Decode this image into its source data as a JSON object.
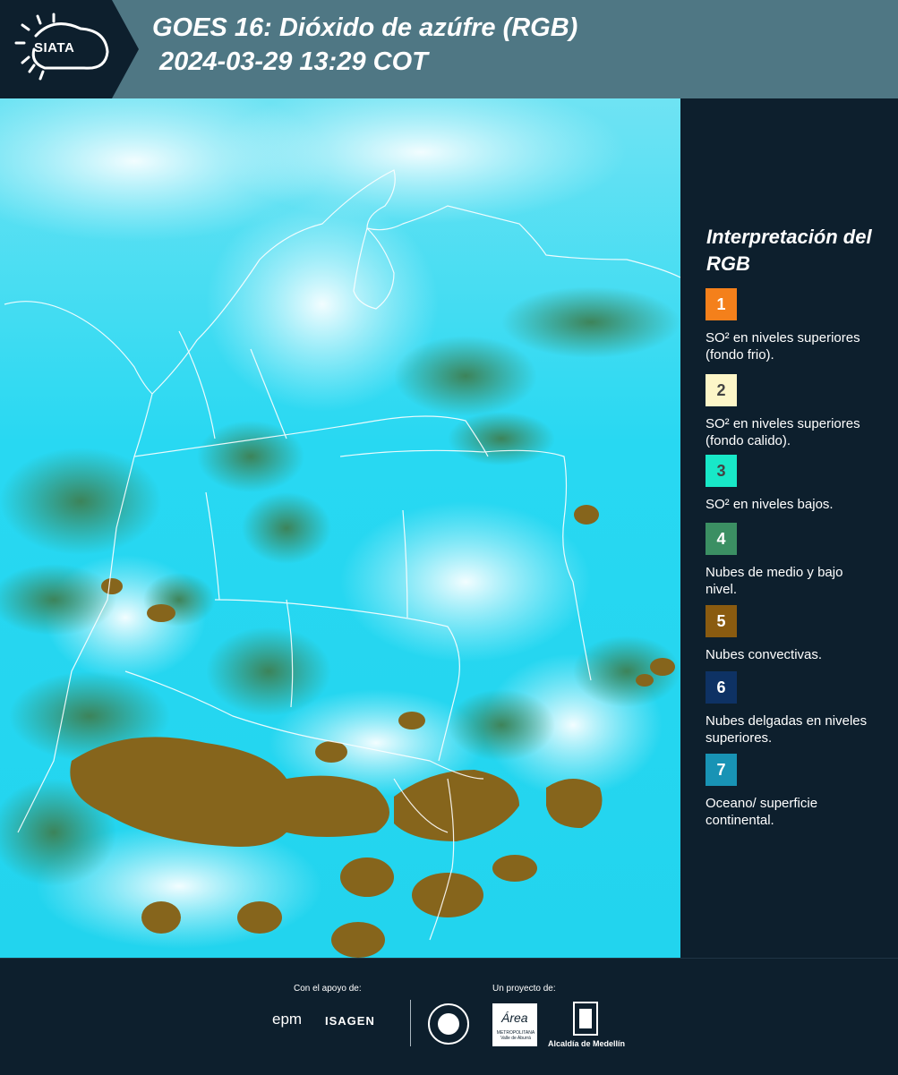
{
  "header": {
    "logo_text": "SIATA",
    "title_line1": "GOES 16: Dióxido de azúfre (RGB)",
    "title_line2": "2024-03-29 13:29 COT"
  },
  "legend": {
    "title": "Interpretación del RGB",
    "items": [
      {
        "number": "1",
        "text": "SO² en niveles superiores (fondo frio).",
        "color": "#f4801b"
      },
      {
        "number": "2",
        "text": "SO² en niveles superiores (fondo calido).",
        "color": "#fdf6c8"
      },
      {
        "number": "3",
        "text": "SO² en niveles bajos.",
        "color": "#18e8c8"
      },
      {
        "number": "4",
        "text": "Nubes de medio y bajo nivel.",
        "color": "#3b8f63"
      },
      {
        "number": "5",
        "text": "Nubes convectivas.",
        "color": "#8a5b10"
      },
      {
        "number": "6",
        "text": "Nubes delgadas en niveles superiores.",
        "color": "#0e3264"
      },
      {
        "number": "7",
        "text": "Oceano/ superficie continental.",
        "color": "#1893b5"
      }
    ]
  },
  "footer": {
    "support_label": "Con el apoyo de:",
    "project_label": "Un proyecto de:",
    "epm_logo": "epm",
    "isagen_logo": "ISAGEN",
    "area_logo": "Área",
    "area_logo_subtitle": "METROPOLITANA Valle de Aburrá",
    "alcaldia_logo": "Alcaldía de Medellín"
  },
  "colors": {
    "header_bg": "#4f7784",
    "panel_bg": "#0d1f2d",
    "map_sky": "#22d6f0",
    "map_cloud_white": "#e6fbfd",
    "map_convective": "#8a6a1c",
    "map_green": "#4a8a5a",
    "border_line": "#ffffff"
  }
}
